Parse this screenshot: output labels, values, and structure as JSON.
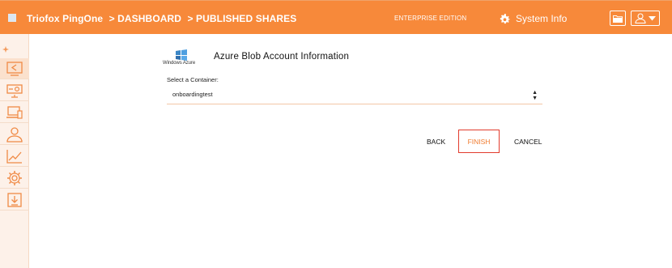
{
  "header": {
    "brand": "Triofox PingOne",
    "crumb_dashboard": "> DASHBOARD",
    "crumb_published": "> PUBLISHED SHARES",
    "edition": "ENTERPRISE EDITION",
    "system_info": "System Info"
  },
  "sidebar": {
    "items": [
      {
        "icon": "share-icon",
        "active": true
      },
      {
        "icon": "monitor-gear-icon"
      },
      {
        "icon": "devices-icon"
      },
      {
        "icon": "user-icon"
      },
      {
        "icon": "chart-icon"
      },
      {
        "icon": "settings-icon"
      },
      {
        "icon": "download-icon"
      }
    ]
  },
  "form": {
    "logo_text": "Windows Azure",
    "title": "Azure Blob Account Information",
    "container_label": "Select a Container:",
    "container_value": "onboardingtest"
  },
  "actions": {
    "back": "BACK",
    "finish": "FINISH",
    "cancel": "CANCEL"
  },
  "colors": {
    "accent": "#f7893a",
    "finish_border": "#e23b2d",
    "sidebar_bg": "#fdf1e9"
  }
}
